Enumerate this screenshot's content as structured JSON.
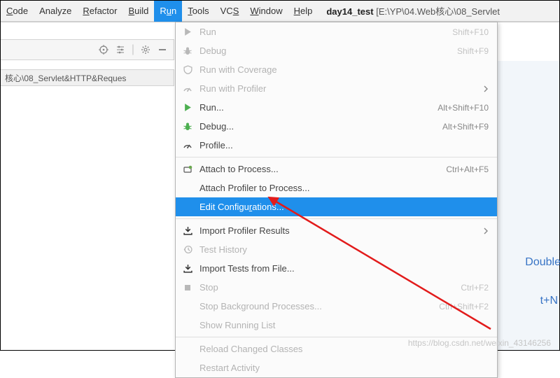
{
  "menubar": {
    "items": [
      {
        "label": "Code",
        "u": 0
      },
      {
        "label": "Analyze",
        "u": -1
      },
      {
        "label": "Refactor",
        "u": 0
      },
      {
        "label": "Build",
        "u": 0
      },
      {
        "label": "Run",
        "u": 1
      },
      {
        "label": "Tools",
        "u": 0
      },
      {
        "label": "VCS",
        "u": 2
      },
      {
        "label": "Window",
        "u": 0
      },
      {
        "label": "Help",
        "u": 0
      }
    ],
    "active_index": 4,
    "project_title": "day14_test",
    "project_path": "[E:\\YP\\04.Web核心\\08_Servlet"
  },
  "pathbar": {
    "text": "核心\\08_Servlet&HTTP&Reques"
  },
  "dropdown": {
    "items": [
      {
        "icon": "play-gray",
        "label": "Run",
        "shortcut": "Shift+F10",
        "dis": true
      },
      {
        "icon": "bug-gray",
        "label": "Debug",
        "shortcut": "Shift+F9",
        "dis": true
      },
      {
        "icon": "shield-gray",
        "label": "Run with Coverage",
        "dis": true
      },
      {
        "icon": "gauge-gray",
        "label": "Run with Profiler",
        "submenu": true,
        "dis": true
      },
      {
        "icon": "play-green",
        "label": "Run...",
        "shortcut": "Alt+Shift+F10"
      },
      {
        "icon": "bug-green",
        "label": "Debug...",
        "shortcut": "Alt+Shift+F9"
      },
      {
        "icon": "gauge",
        "label": "Profile..."
      },
      {
        "sep": true
      },
      {
        "icon": "attach",
        "label": "Attach to Process...",
        "shortcut": "Ctrl+Alt+F5"
      },
      {
        "icon": "",
        "label": "Attach Profiler to Process..."
      },
      {
        "icon": "",
        "label": "Edit Configurations...",
        "selected": true,
        "u": 12
      },
      {
        "sep": true
      },
      {
        "icon": "import",
        "label": "Import Profiler Results",
        "submenu": true
      },
      {
        "icon": "history-gray",
        "label": "Test History",
        "dis": true
      },
      {
        "icon": "import",
        "label": "Import Tests from File..."
      },
      {
        "icon": "stop-gray",
        "label": "Stop",
        "shortcut": "Ctrl+F2",
        "dis": true
      },
      {
        "icon": "",
        "label": "Stop Background Processes...",
        "shortcut": "Ctrl+Shift+F2",
        "dis": true
      },
      {
        "icon": "",
        "label": "Show Running List",
        "dis": true
      },
      {
        "sep": true
      },
      {
        "icon": "",
        "label": "Reload Changed Classes",
        "dis": true
      },
      {
        "icon": "",
        "label": "Restart Activity",
        "dis": true
      }
    ]
  },
  "right": {
    "text1": "Double Sh",
    "text2": "t+N"
  },
  "watermark": "https://blog.csdn.net/weixin_43146256"
}
